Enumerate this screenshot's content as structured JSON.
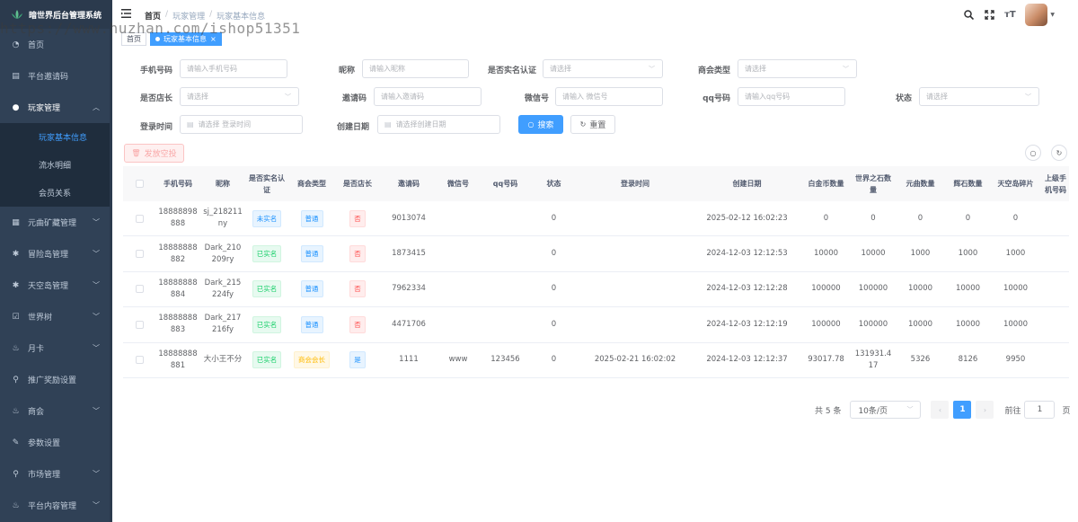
{
  "app": {
    "title": "暗世界后台管理系统"
  },
  "watermark": "https://www.huzhan.com/ishop51351",
  "sidebar": {
    "items": [
      {
        "label": "首页",
        "icon": "dashboard-icon",
        "has_children": false
      },
      {
        "label": "平台邀请码",
        "icon": "document-icon",
        "has_children": false
      },
      {
        "label": "玩家管理",
        "icon": "user-icon",
        "has_children": true,
        "expanded": true,
        "children": [
          {
            "label": "玩家基本信息",
            "active": true
          },
          {
            "label": "流水明细"
          },
          {
            "label": "会员关系"
          }
        ]
      },
      {
        "label": "元曲矿藏管理",
        "icon": "grid-icon",
        "has_children": true
      },
      {
        "label": "冒险岛管理",
        "icon": "bug-icon",
        "has_children": true
      },
      {
        "label": "天空岛管理",
        "icon": "bug-icon",
        "has_children": true
      },
      {
        "label": "世界树",
        "icon": "checkbox-icon",
        "has_children": true
      },
      {
        "label": "月卡",
        "icon": "people-icon",
        "has_children": true
      },
      {
        "label": "推广奖励设置",
        "icon": "tree-icon",
        "has_children": false
      },
      {
        "label": "商会",
        "icon": "people-icon",
        "has_children": true
      },
      {
        "label": "参数设置",
        "icon": "edit-icon",
        "has_children": false
      },
      {
        "label": "市场管理",
        "icon": "tree-icon",
        "has_children": true
      },
      {
        "label": "平台内容管理",
        "icon": "people-icon",
        "has_children": true
      }
    ]
  },
  "header": {
    "breadcrumb": [
      "首页",
      "玩家管理",
      "玩家基本信息"
    ],
    "tags": [
      {
        "label": "首页",
        "active": false
      },
      {
        "label": "玩家基本信息",
        "active": true
      }
    ],
    "right_icons": [
      "search-icon",
      "fullscreen-icon",
      "font-size-icon"
    ],
    "font_size_glyph": "тT"
  },
  "filters": {
    "phone": {
      "label": "手机号码",
      "placeholder": "请输入手机号码"
    },
    "nickname": {
      "label": "昵称",
      "placeholder": "请输入昵称"
    },
    "realname": {
      "label": "是否实名认证",
      "placeholder": "请选择"
    },
    "chamber_type": {
      "label": "商会类型",
      "placeholder": "请选择"
    },
    "is_shop": {
      "label": "是否店长",
      "placeholder": "请选择"
    },
    "invite_code": {
      "label": "邀请码",
      "placeholder": "请输入邀请码"
    },
    "wechat": {
      "label": "微信号",
      "placeholder": "请输入 微信号"
    },
    "qq": {
      "label": "qq号码",
      "placeholder": "请输入qq号码"
    },
    "status": {
      "label": "状态",
      "placeholder": "请选择"
    },
    "login_time": {
      "label": "登录时间",
      "placeholder": "请选择 登录时间"
    },
    "create_date": {
      "label": "创建日期",
      "placeholder": "请选择创建日期"
    },
    "search_button": "搜索",
    "reset_button": "重置",
    "grant_button": "发放空投"
  },
  "table": {
    "columns": [
      "手机号码",
      "昵称",
      "是否实名认证",
      "商会类型",
      "是否店长",
      "邀请码",
      "微信号",
      "qq号码",
      "状态",
      "登录时间",
      "创建日期",
      "白金币数量",
      "世界之石数量",
      "元曲数量",
      "辉石数量",
      "天空岛碎片",
      "上级手机号码"
    ],
    "rows": [
      {
        "phone": "18888898888",
        "nickname": "sj_218211ny",
        "realname": "未实名",
        "realname_ok": false,
        "chamber": "普通",
        "chamber_gold": false,
        "shop": "否",
        "shop_yes": false,
        "invite": "9013074",
        "wechat": "",
        "qq": "",
        "status": "0",
        "login": "",
        "created": "2025-02-12 16:02:23",
        "platinum": "0",
        "world_stone": "0",
        "yuanqu": "0",
        "huishi": "0",
        "sky_shard": "0",
        "parent_phone": ""
      },
      {
        "phone": "18888888882",
        "nickname": "Dark_210209ry",
        "realname": "已实名",
        "realname_ok": true,
        "chamber": "普通",
        "chamber_gold": false,
        "shop": "否",
        "shop_yes": false,
        "invite": "1873415",
        "wechat": "",
        "qq": "",
        "status": "0",
        "login": "",
        "created": "2024-12-03 12:12:53",
        "platinum": "10000",
        "world_stone": "10000",
        "yuanqu": "1000",
        "huishi": "1000",
        "sky_shard": "1000",
        "parent_phone": ""
      },
      {
        "phone": "18888888884",
        "nickname": "Dark_215224fy",
        "realname": "已实名",
        "realname_ok": true,
        "chamber": "普通",
        "chamber_gold": false,
        "shop": "否",
        "shop_yes": false,
        "invite": "7962334",
        "wechat": "",
        "qq": "",
        "status": "0",
        "login": "",
        "created": "2024-12-03 12:12:28",
        "platinum": "100000",
        "world_stone": "100000",
        "yuanqu": "10000",
        "huishi": "10000",
        "sky_shard": "10000",
        "parent_phone": ""
      },
      {
        "phone": "18888888883",
        "nickname": "Dark_217216fy",
        "realname": "已实名",
        "realname_ok": true,
        "chamber": "普通",
        "chamber_gold": false,
        "shop": "否",
        "shop_yes": false,
        "invite": "4471706",
        "wechat": "",
        "qq": "",
        "status": "0",
        "login": "",
        "created": "2024-12-03 12:12:19",
        "platinum": "100000",
        "world_stone": "100000",
        "yuanqu": "10000",
        "huishi": "10000",
        "sky_shard": "10000",
        "parent_phone": ""
      },
      {
        "phone": "18888888881",
        "nickname": "大小王不分",
        "realname": "已实名",
        "realname_ok": true,
        "chamber": "商会会长",
        "chamber_gold": true,
        "shop": "是",
        "shop_yes": true,
        "invite": "1111",
        "wechat": "www",
        "qq": "123456",
        "status": "0",
        "login": "2025-02-21 16:02:02",
        "created": "2024-12-03 12:12:37",
        "platinum": "93017.78",
        "world_stone": "131931.417",
        "yuanqu": "5326",
        "huishi": "8126",
        "sky_shard": "9950",
        "parent_phone": ""
      }
    ]
  },
  "pagination": {
    "total_text": "共 5 条",
    "page_size": "10条/页",
    "current_page": "1",
    "goto_label": "前往",
    "goto_value": "1",
    "page_suffix": "页"
  },
  "colors": {
    "sidebar_bg": "#304156",
    "primary": "#409eff",
    "active_menu": "#409eff"
  }
}
